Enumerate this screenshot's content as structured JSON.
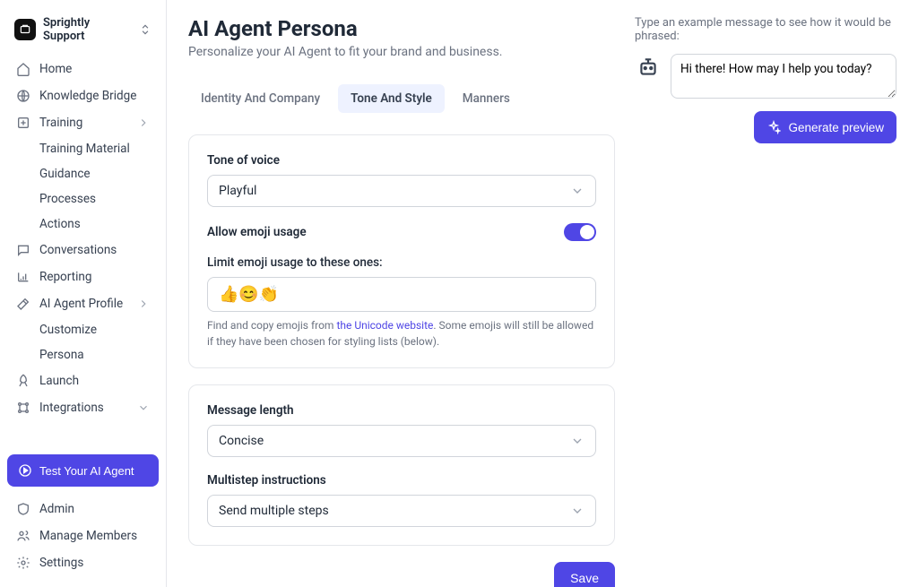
{
  "workspace": {
    "name": "Sprightly Support"
  },
  "sidebar": {
    "items": [
      {
        "label": "Home"
      },
      {
        "label": "Knowledge Bridge"
      },
      {
        "label": "Training"
      },
      {
        "label": "Conversations"
      },
      {
        "label": "Reporting"
      },
      {
        "label": "AI Agent Profile"
      },
      {
        "label": "Launch"
      },
      {
        "label": "Integrations"
      }
    ],
    "training_sub": [
      {
        "label": "Training Material"
      },
      {
        "label": "Guidance"
      },
      {
        "label": "Processes"
      },
      {
        "label": "Actions"
      }
    ],
    "profile_sub": [
      {
        "label": "Customize"
      },
      {
        "label": "Persona"
      }
    ],
    "test_button": "Test Your AI Agent",
    "bottom": [
      {
        "label": "Admin"
      },
      {
        "label": "Manage Members"
      },
      {
        "label": "Settings"
      }
    ]
  },
  "page": {
    "title": "AI Agent Persona",
    "subtitle": "Personalize your AI Agent to fit your brand and business."
  },
  "tabs": [
    {
      "label": "Identity And Company"
    },
    {
      "label": "Tone And Style"
    },
    {
      "label": "Manners"
    }
  ],
  "tone_card": {
    "tone_label": "Tone of voice",
    "tone_value": "Playful",
    "emoji_toggle_label": "Allow emoji usage",
    "emoji_toggle_on": true,
    "emoji_limit_label": "Limit emoji usage to these ones:",
    "emoji_value": "👍😊👏",
    "help_prefix": "Find and copy emojis from ",
    "help_link": "the Unicode website",
    "help_suffix": ". Some emojis will still be allowed if they have been chosen for styling lists (below)."
  },
  "message_card": {
    "length_label": "Message length",
    "length_value": "Concise",
    "multistep_label": "Multistep instructions",
    "multistep_value": "Send multiple steps"
  },
  "save_button": "Save",
  "preview": {
    "hint": "Type an example message to see how it would be phrased:",
    "value": "Hi there! How may I help you today?",
    "generate_button": "Generate preview"
  }
}
